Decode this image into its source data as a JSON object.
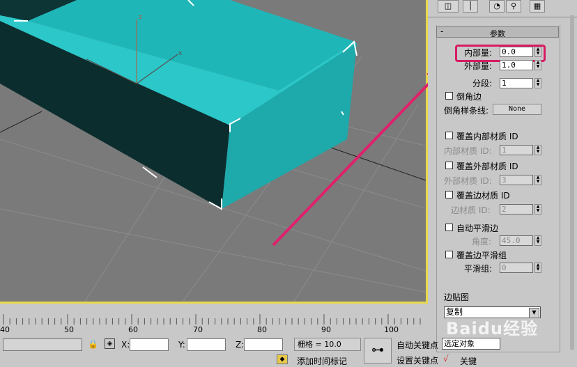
{
  "params": {
    "rollout_title": "参数",
    "inner_amount_label": "内部量:",
    "inner_amount_value": "0.0",
    "outer_amount_label": "外部量:",
    "outer_amount_value": "1.0",
    "segments_label": "分段:",
    "segments_value": "1",
    "bevel_edges_label": "倒角边",
    "bevel_spline_label": "倒角样条线:",
    "bevel_spline_value": "None",
    "override_inside_mat_label": "覆盖内部材质 ID",
    "inside_mat_id_label": "内部材质 ID:",
    "inside_mat_id_value": "1",
    "override_outside_mat_label": "覆盖外部材质 ID",
    "outside_mat_id_label": "外部材质 ID:",
    "outside_mat_id_value": "3",
    "override_edge_mat_label": "覆盖边材质 ID",
    "edge_mat_id_label": "边材质 ID:",
    "edge_mat_id_value": "2",
    "auto_smooth_label": "自动平滑边",
    "angle_label": "角度:",
    "angle_value": "45.0",
    "override_edge_smooth_label": "覆盖边平滑组",
    "smooth_group_label": "平滑组:",
    "smooth_group_value": "0",
    "edge_map_label": "边贴图",
    "edge_map_value": "复制"
  },
  "timeline": {
    "ticks": [
      "40",
      "50",
      "60",
      "70",
      "80",
      "90",
      "100"
    ]
  },
  "status": {
    "x_label": "X:",
    "y_label": "Y:",
    "z_label": "Z:",
    "grid_label": "栅格 = 10.0",
    "add_time_tag": "添加时间标记",
    "auto_key": "自动关键点",
    "set_key": "设置关键点",
    "selection_dropdown": "选定对象",
    "key_filters": "关键"
  },
  "viewport": {
    "axis_x": "x",
    "axis_z": "z"
  },
  "watermark": "Baidu经验",
  "colors": {
    "highlight": "#d81b64",
    "viewport_border": "#e8d84a",
    "box_inner": "#1fb6b8",
    "box_outer": "#0b2d2e"
  }
}
